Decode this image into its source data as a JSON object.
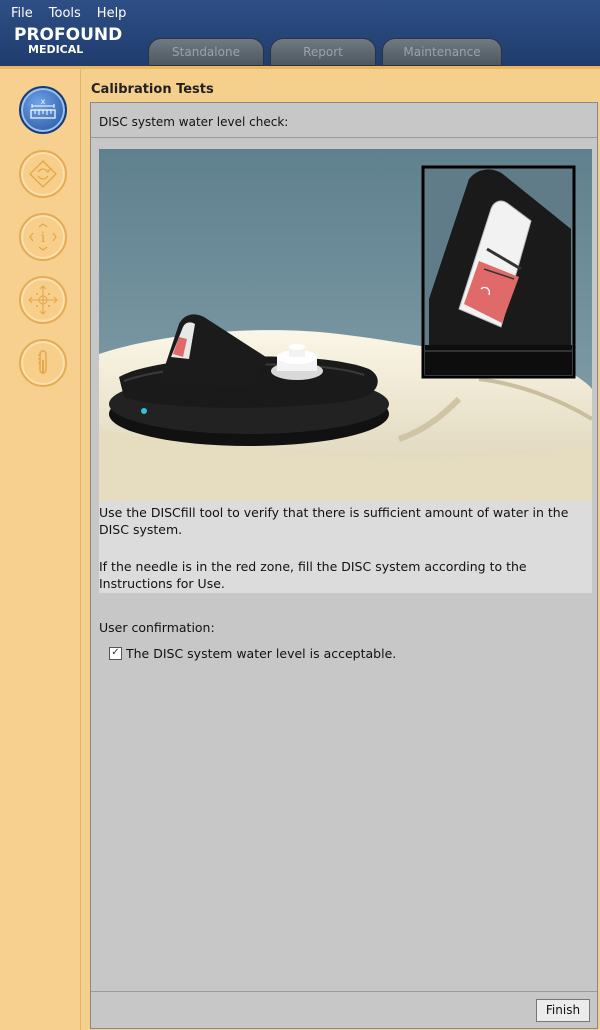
{
  "menu": [
    "File",
    "Tools",
    "Help"
  ],
  "logo": {
    "line1": "PROFOUND",
    "line2": "MEDICAL"
  },
  "tabs": [
    {
      "label": "Standalone"
    },
    {
      "label": "Report"
    },
    {
      "label": "Maintenance"
    }
  ],
  "sidebar": {
    "items": [
      {
        "icon": "ruler-icon",
        "state": "active"
      },
      {
        "icon": "rotation-icon",
        "state": "inactive"
      },
      {
        "icon": "info-icon",
        "state": "inactive"
      },
      {
        "icon": "crosshair-icon",
        "state": "inactive"
      },
      {
        "icon": "thermometer-icon",
        "state": "inactive"
      }
    ]
  },
  "page": {
    "title": "Calibration Tests",
    "step_label": "DISC system water level check:",
    "instructions": {
      "p1": "Use the DISCfill tool to verify that there is sufficient amount of water in the DISC system.",
      "p2": "If the needle is in the red zone, fill the DISC system according to the Instructions for Use."
    },
    "confirmation": {
      "label": "User confirmation:",
      "checkbox_text": "The DISC system water level is acceptable.",
      "checked": true
    },
    "finish_label": "Finish"
  },
  "colors": {
    "topbar": "#1f3c6d",
    "sidebar": "#f7d08f",
    "panel": "#c7c7c7",
    "illustration_bg": "#6e8d9a",
    "red_zone": "#e06a6a"
  }
}
